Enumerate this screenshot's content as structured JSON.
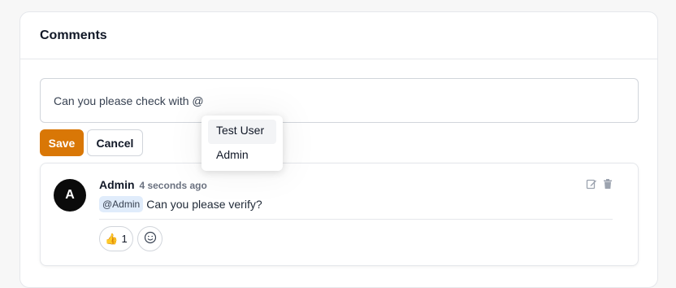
{
  "panel": {
    "title": "Comments"
  },
  "editor": {
    "value": "Can you please check with @"
  },
  "buttons": {
    "save": "Save",
    "cancel": "Cancel"
  },
  "mention_dropdown": {
    "items": [
      "Test User",
      "Admin"
    ],
    "highlighted": "Test User"
  },
  "comment": {
    "avatar_initial": "A",
    "author": "Admin",
    "time": "4 seconds ago",
    "mention": "@Admin",
    "text": "Can you please verify?",
    "reactions": [
      {
        "emoji": "👍",
        "count": "1"
      }
    ],
    "icons": [
      "edit-icon",
      "trash-icon",
      "add-reaction-icon"
    ]
  },
  "colors": {
    "accent": "#d97706",
    "mention_bg": "#e0ecfb",
    "avatar_bg": "#0b0b0b"
  }
}
